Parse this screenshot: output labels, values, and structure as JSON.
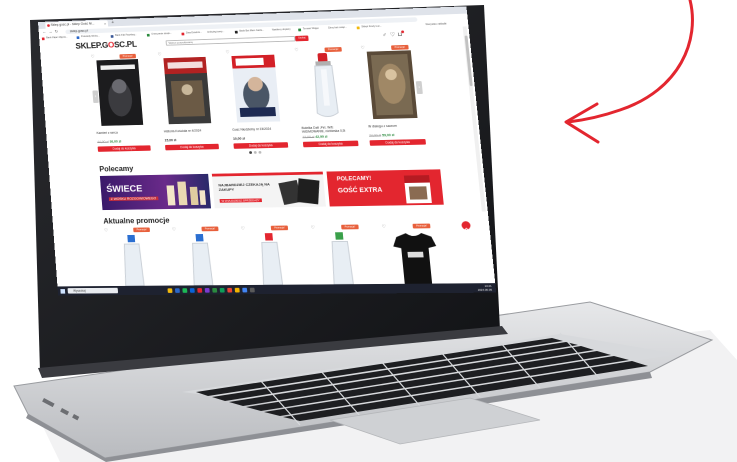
{
  "browser": {
    "tab_title": "Sklep.gosc.pl - Sklep Gość Ni...",
    "tab_close": "×",
    "new_tab": "+",
    "nav_back": "←",
    "nav_forward": "→",
    "nav_reload": "↻",
    "url": "sklep.gosc.pl",
    "bookmarks": [
      "Bank Zajac zdjęcia...",
      "Protokoły Wolny...",
      "Bank Fak Facebog...",
      "Orzeczenie doręk...",
      "Dwa Dzielnik...",
      "Ionbyteg iorep...",
      "Bank Bot Marn Garta...",
      "Nartikery obpiszy",
      "Tomasz Wojęo",
      "Dimy kań osiąc...",
      "Sklepi Krazy Łuc..."
    ],
    "bookmarks_right": "Wszystkie zakładki"
  },
  "header": {
    "logo_left": "SKLEP.G",
    "logo_o": "O",
    "logo_right": "SC.PL",
    "search_placeholder": "Wpisz poszukiwaną",
    "search_button": "Szukaj",
    "icons": [
      "user-icon",
      "heart-icon",
      "cart-icon"
    ]
  },
  "products": [
    {
      "name": "Kamień z serca",
      "old_price": "44,90 zł",
      "new_price": "36,00 zł",
      "badge": "Promocja!",
      "button": "Dodaj do koszyka"
    },
    {
      "name": "Historia Kościoła nr 4/2024",
      "old_price": "",
      "new_price": "15,00 zł",
      "badge": "",
      "button": "Dodaj do koszyka"
    },
    {
      "name": "Gość Niedzielny nr 23/2024",
      "old_price": "",
      "new_price": "10,00 zł",
      "badge": "",
      "button": "Dodaj do koszyka"
    },
    {
      "name": "Butelka Dafi ,Pet. W/E WIDMOWANIE, niebieska 0,5l",
      "old_price": "72,00 zł",
      "new_price": "42,99 zł",
      "badge": "Promocja!",
      "button": "Dodaj do koszyka"
    },
    {
      "name": "W dialogu z sacrum",
      "old_price": "74,00 zł",
      "new_price": "59,00 zł",
      "badge": "Promocja!",
      "button": "Dodaj do koszyka"
    }
  ],
  "carousel_prev": "‹",
  "carousel_next": "›",
  "polecamy": {
    "title": "Polecamy",
    "banners": [
      {
        "big": "ŚWIECE",
        "small": "Z WOSKU ROZGOWIOWEGO"
      },
      {
        "big": "NAJBARDZIEJ CZEKAJĄ NA ZAKUPY",
        "small": "W ZNAJDZIESZ SPRZEDAŻY"
      },
      {
        "big": "GOŚĆ EXTRA",
        "small": "POLECAMY!"
      }
    ]
  },
  "promocje": {
    "title": "Aktualne promocje",
    "badge": "Promocja!"
  },
  "taskbar": {
    "search": "Wyszukaj",
    "time": "13:21",
    "date": "2024-06-05"
  },
  "colors": {
    "accent": "#e3262f",
    "badge": "#e8603c",
    "annotation_arrow": "#e3262f",
    "price_green": "#2b8a3e",
    "laptop_body": "#c8cacd"
  }
}
